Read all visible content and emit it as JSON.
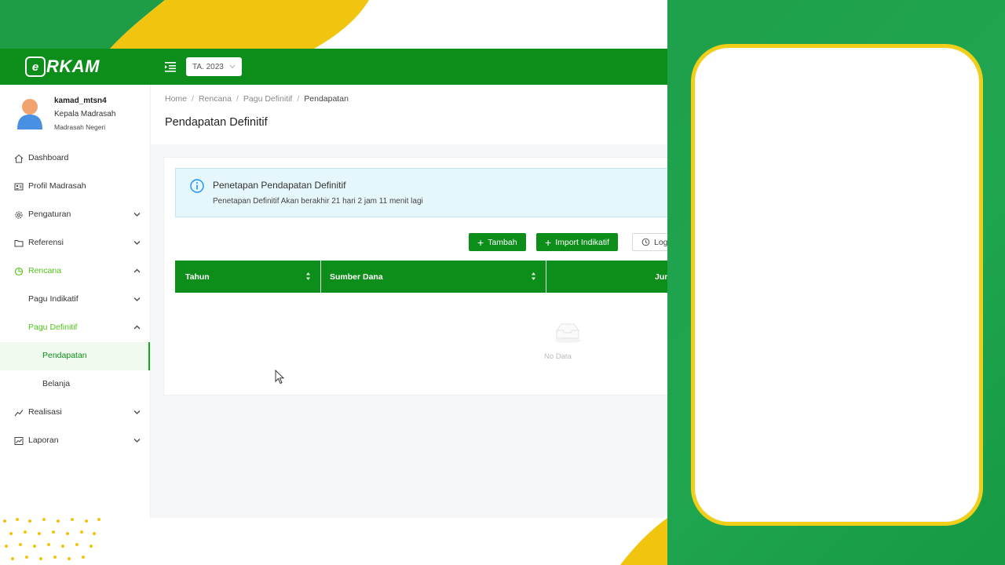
{
  "header": {
    "logo_text": "RKAM",
    "logo_mark": "e",
    "menu_icon": "menu-fold-icon",
    "year_select": "TA. 2023"
  },
  "user": {
    "name": "kamad_mtsn4",
    "role": "Kepala Madrasah",
    "org": "Madrasah Negeri"
  },
  "sidebar": {
    "items": [
      {
        "label": "Dashboard",
        "icon": "home-icon"
      },
      {
        "label": "Profil Madrasah",
        "icon": "profile-card-icon"
      },
      {
        "label": "Pengaturan",
        "icon": "gear-icon"
      },
      {
        "label": "Referensi",
        "icon": "folder-icon"
      },
      {
        "label": "Rencana",
        "icon": "pie-chart-icon"
      },
      {
        "label": "Pagu Indikatif"
      },
      {
        "label": "Pagu Definitif"
      },
      {
        "label": "Pendapatan"
      },
      {
        "label": "Belanja"
      },
      {
        "label": "Realisasi",
        "icon": "line-chart-icon"
      },
      {
        "label": "Laporan",
        "icon": "area-chart-icon"
      }
    ]
  },
  "breadcrumb": [
    "Home",
    "Rencana",
    "Pagu Definitif",
    "Pendapatan"
  ],
  "page_title": "Pendapatan Definitif",
  "alert": {
    "title": "Penetapan Pendapatan Definitif",
    "description": "Penetapan Definitif Akan berakhir 21 hari 2 jam 11 menit lagi"
  },
  "toolbar": {
    "add_label": "Tambah",
    "import_label": "Import Indikatif",
    "log_label": "Log"
  },
  "table": {
    "columns": [
      "Tahun",
      "Sumber Dana",
      "Jum"
    ],
    "empty_text": "No Data"
  },
  "colors": {
    "primary_green": "#0d8e1a",
    "accent_yellow": "#f1c40f",
    "right_panel_green": "#1fa04a"
  }
}
